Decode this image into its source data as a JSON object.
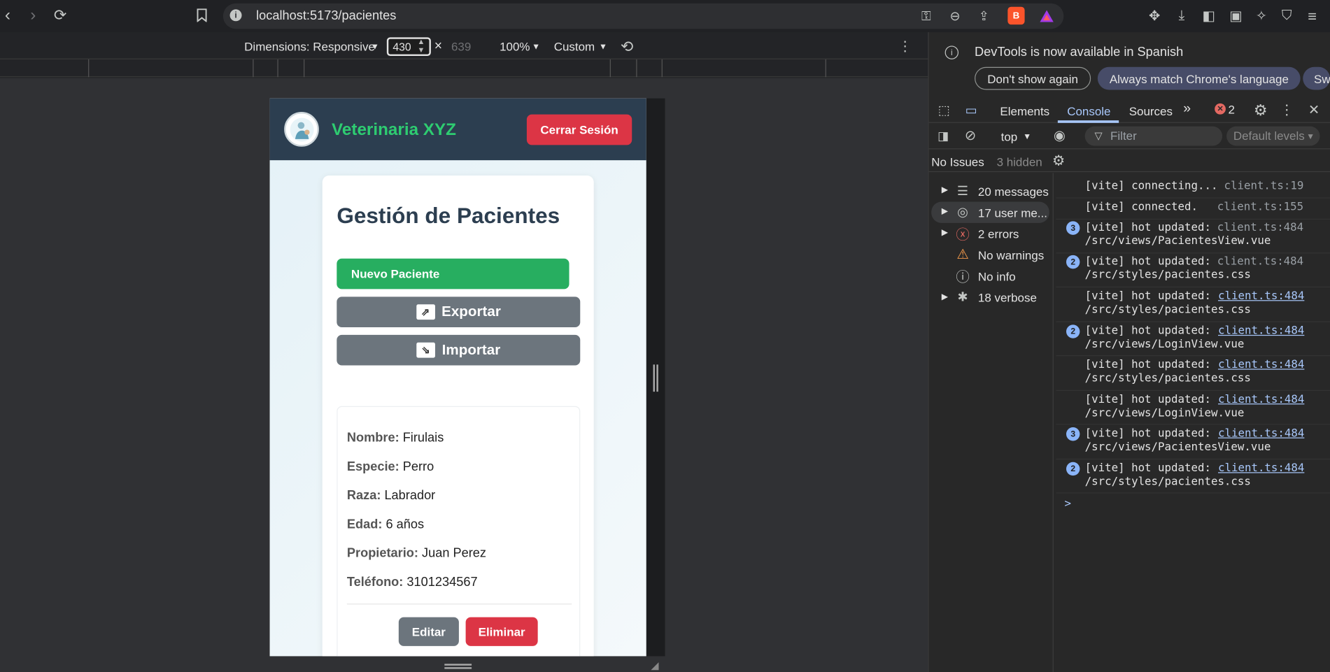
{
  "browser": {
    "url": "localhost:5173/pacientes"
  },
  "device_toolbar": {
    "dimensions_label": "Dimensions: Responsive",
    "width": "430",
    "times": "×",
    "height": "639",
    "zoom": "100%",
    "throttle": "Custom"
  },
  "app": {
    "title": "Veterinaria XYZ",
    "logout_label": "Cerrar Sesión",
    "page_title": "Gestión de Pacientes",
    "new_patient_label": "Nuevo Paciente",
    "export_label": "Exportar",
    "import_label": "Importar",
    "patient": {
      "name_label": "Nombre:",
      "name": "Firulais",
      "species_label": "Especie:",
      "species": "Perro",
      "breed_label": "Raza:",
      "breed": "Labrador",
      "age_label": "Edad:",
      "age": "6 años",
      "owner_label": "Propietario:",
      "owner": "Juan Perez",
      "phone_label": "Teléfono:",
      "phone": "3101234567"
    },
    "edit_label": "Editar",
    "delete_label": "Eliminar"
  },
  "devtools": {
    "notice": "DevTools is now available in Spanish",
    "dont_show": "Don't show again",
    "match_language": "Always match Chrome's language",
    "switch_partial": "Sw",
    "tabs": [
      "Elements",
      "Console",
      "Sources"
    ],
    "error_count": "2",
    "context": "top",
    "filter_placeholder": "Filter",
    "levels": "Default levels",
    "no_issues": "No Issues",
    "hidden": "3 hidden",
    "sidebar": [
      {
        "label": "20 messages",
        "icon": "list-icon"
      },
      {
        "label": "17 user me...",
        "icon": "user-icon"
      },
      {
        "label": "2 errors",
        "icon": "error-icon"
      },
      {
        "label": "No warnings",
        "icon": "warning-icon"
      },
      {
        "label": "No info",
        "icon": "info-icon"
      },
      {
        "label": "18 verbose",
        "icon": "bug-icon"
      }
    ],
    "logs": [
      {
        "msg": "[vite] connecting...",
        "src": "client.ts:19",
        "badge": ""
      },
      {
        "msg": "[vite] connected.",
        "src": "client.ts:155",
        "badge": ""
      },
      {
        "msg": "[vite] hot updated:\n/src/views/PacientesView.vue",
        "src": "client.ts:484",
        "badge": "3"
      },
      {
        "msg": "[vite] hot updated:\n/src/styles/pacientes.css",
        "src": "client.ts:484",
        "badge": "2"
      },
      {
        "msg": "[vite] hot updated:\n/src/styles/pacientes.css",
        "src": "client.ts:484",
        "badge": ""
      },
      {
        "msg": "[vite] hot updated:\n/src/views/LoginView.vue",
        "src": "client.ts:484",
        "badge": "2"
      },
      {
        "msg": "[vite] hot updated:\n/src/styles/pacientes.css",
        "src": "client.ts:484",
        "badge": ""
      },
      {
        "msg": "[vite] hot updated:\n/src/views/LoginView.vue",
        "src": "client.ts:484",
        "badge": ""
      },
      {
        "msg": "[vite] hot updated:\n/src/views/PacientesView.vue",
        "src": "client.ts:484",
        "badge": "3"
      },
      {
        "msg": "[vite] hot updated:\n/src/styles/pacientes.css",
        "src": "client.ts:484",
        "badge": "2"
      }
    ],
    "prompt": ">"
  }
}
